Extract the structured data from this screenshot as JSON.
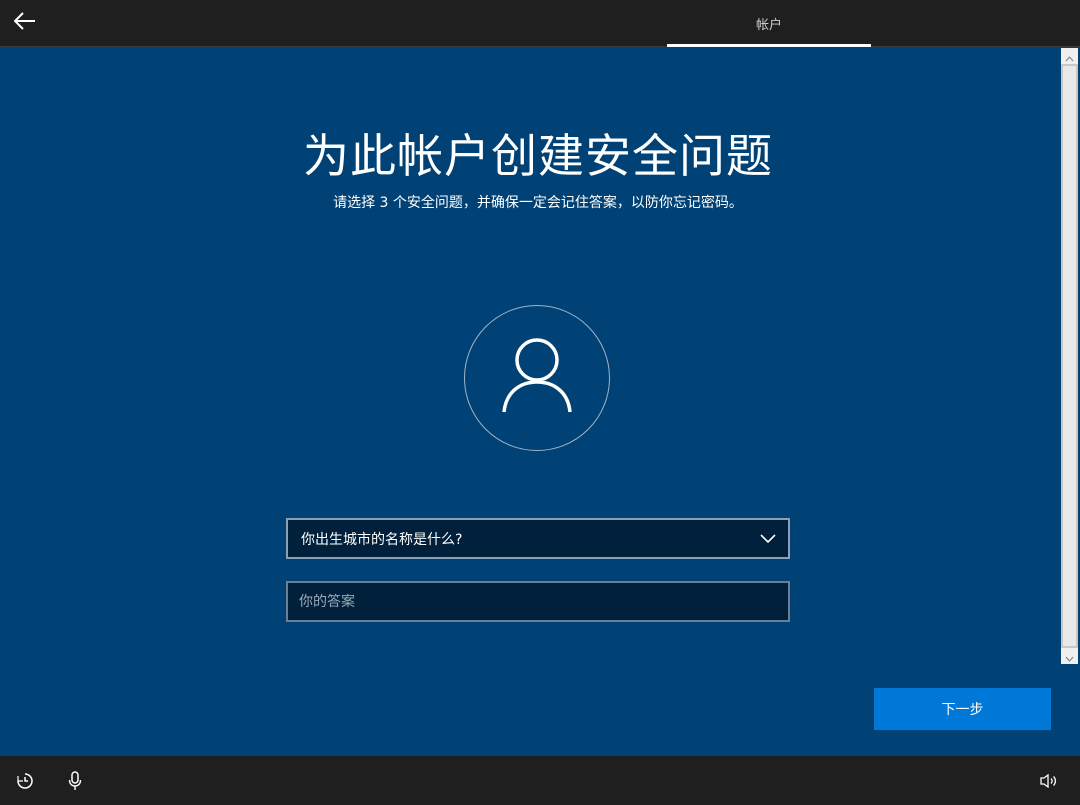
{
  "header": {
    "back_icon": "arrow-left-icon",
    "step_label": "帐户"
  },
  "main": {
    "title": "为此帐户创建安全问题",
    "subtitle": "请选择 3 个安全问题，并确保一定会记住答案，以防你忘记密码。",
    "avatar_icon": "user-icon",
    "question_select": {
      "selected_value": "你出生城市的名称是什么?",
      "chevron_icon": "chevron-down-icon"
    },
    "answer_input": {
      "value": "",
      "placeholder": "你的答案"
    },
    "next_button_label": "下一步"
  },
  "footer": {
    "icons": [
      "ease-of-access-icon",
      "microphone-icon",
      "volume-icon"
    ]
  },
  "colors": {
    "panel_background": "#004275",
    "bar_background": "#1f1f1f",
    "accent": "#0078d7",
    "field_background": "#00203b"
  }
}
